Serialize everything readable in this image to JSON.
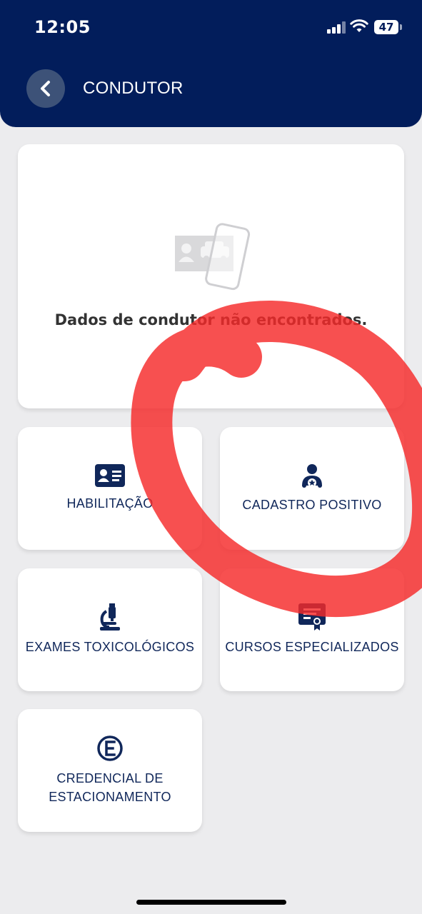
{
  "status_bar": {
    "time": "12:05",
    "battery": "47",
    "signal_icon": "signal-icon",
    "wifi_icon": "wifi-icon"
  },
  "header": {
    "title": "CONDUTOR",
    "back_icon": "chevron-left-icon",
    "background": "#021d5b"
  },
  "info_card": {
    "icon": "driver-car-phone-icon",
    "message": "Dados de condutor não encontrados."
  },
  "tiles": [
    {
      "label": "HABILITAÇÃO",
      "icon": "id-card-icon"
    },
    {
      "label": "CADASTRO POSITIVO",
      "icon": "user-star-icon"
    },
    {
      "label": "EXAMES TOXICOLÓGICOS",
      "icon": "microscope-icon"
    },
    {
      "label": "CURSOS ESPECIALIZADOS",
      "icon": "certificate-icon"
    },
    {
      "label": "CREDENCIAL DE\nESTACIONAMENTO",
      "icon": "parking-e-icon"
    }
  ],
  "colors": {
    "accent": "#10275a",
    "page_background": "#ececee",
    "annotation": "#f52a2a"
  }
}
